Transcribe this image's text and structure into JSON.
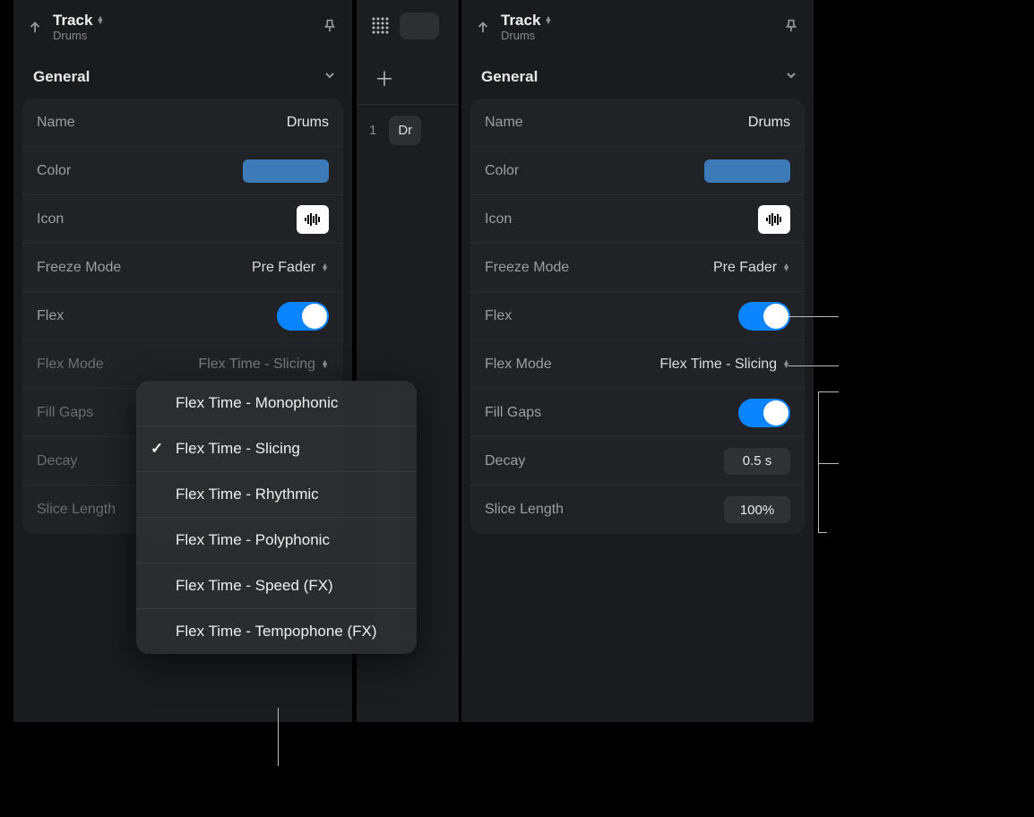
{
  "header": {
    "title": "Track",
    "subtitle": "Drums"
  },
  "section": "General",
  "rows": {
    "name_label": "Name",
    "name_value": "Drums",
    "color_label": "Color",
    "color_hex": "#3d7bb8",
    "icon_label": "Icon",
    "freeze_label": "Freeze Mode",
    "freeze_value": "Pre Fader",
    "flex_label": "Flex",
    "flexmode_label": "Flex Mode",
    "flexmode_value": "Flex Time - Slicing",
    "fillgaps_label": "Fill Gaps",
    "decay_label": "Decay",
    "decay_value": "0.5 s",
    "slicelen_label": "Slice Length",
    "slicelen_value": "100%"
  },
  "popup": {
    "items": [
      "Flex Time - Monophonic",
      "Flex Time - Slicing",
      "Flex Time - Rhythmic",
      "Flex Time - Polyphonic",
      "Flex Time - Speed (FX)",
      "Flex Time - Tempophone (FX)"
    ],
    "selected": 1
  },
  "mid": {
    "tracknum": "1",
    "trackname": "Dr"
  }
}
